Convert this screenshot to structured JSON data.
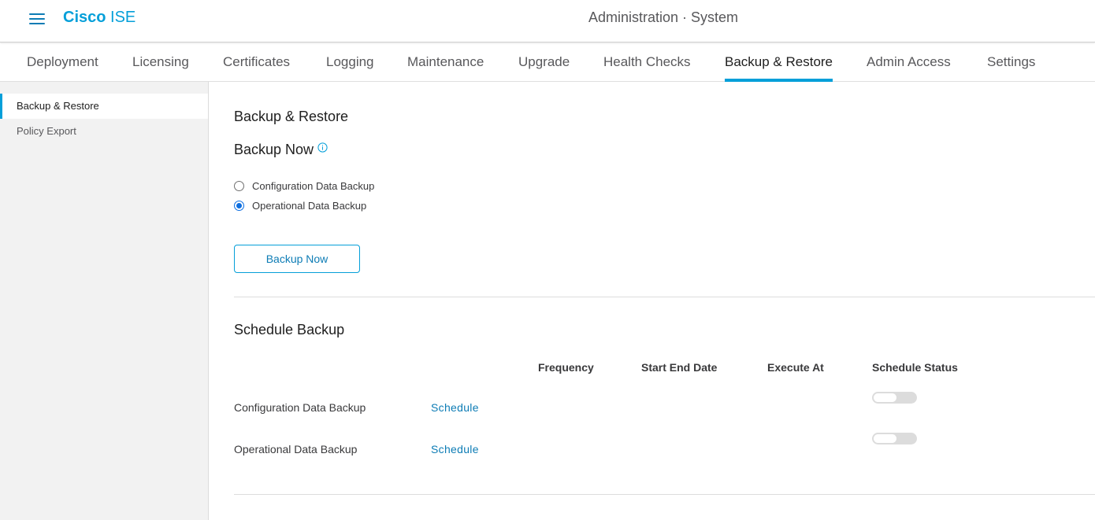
{
  "header": {
    "brand_name": "Cisco",
    "product_name": "ISE",
    "page_title": "Administration · System",
    "icons": {
      "menu": "hamburger-menu-icon"
    }
  },
  "tabs": [
    {
      "label": "Deployment",
      "active": false
    },
    {
      "label": "Licensing",
      "active": false
    },
    {
      "label": "Certificates",
      "active": false
    },
    {
      "label": "Logging",
      "active": false
    },
    {
      "label": "Maintenance",
      "active": false
    },
    {
      "label": "Upgrade",
      "active": false
    },
    {
      "label": "Health Checks",
      "active": false
    },
    {
      "label": "Backup & Restore",
      "active": true
    },
    {
      "label": "Admin Access",
      "active": false
    },
    {
      "label": "Settings",
      "active": false
    }
  ],
  "sidebar": {
    "items": [
      {
        "label": "Backup & Restore",
        "active": true
      },
      {
        "label": "Policy Export",
        "active": false
      }
    ]
  },
  "main": {
    "heading": "Backup & Restore",
    "backup_now": {
      "title": "Backup Now",
      "info_icon": "info-icon",
      "options": [
        {
          "label": "Configuration Data Backup",
          "checked": false
        },
        {
          "label": "Operational Data Backup",
          "checked": true
        }
      ],
      "button_label": "Backup Now"
    },
    "schedule_backup": {
      "title": "Schedule Backup",
      "columns": [
        "Frequency",
        "Start End Date",
        "Execute At",
        "Schedule Status"
      ],
      "rows": [
        {
          "label": "Configuration Data Backup",
          "action": "Schedule",
          "frequency": "",
          "start_end_date": "",
          "execute_at": "",
          "status_enabled": false
        },
        {
          "label": "Operational Data Backup",
          "action": "Schedule",
          "frequency": "",
          "start_end_date": "",
          "execute_at": "",
          "status_enabled": false
        }
      ]
    }
  },
  "colors": {
    "accent": "#049fd9",
    "link": "#0d7cb5",
    "radio_checked": "#0d6ee0",
    "sidebar_bg": "#f2f2f2",
    "toggle_off": "#dcdcdc"
  }
}
